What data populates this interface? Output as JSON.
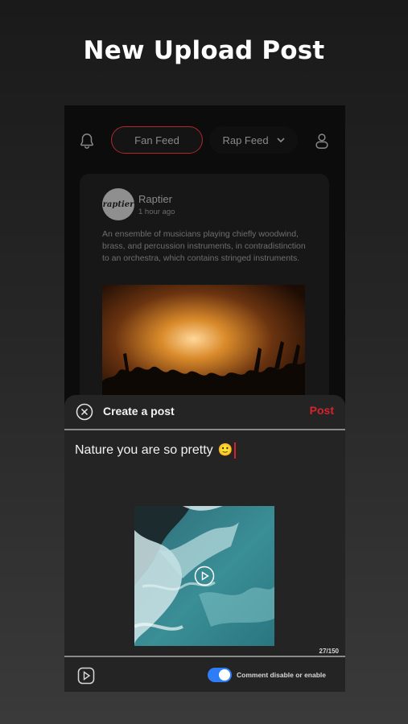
{
  "headline": "New Upload Post",
  "feed": {
    "tabs": [
      {
        "label": "Fan Feed",
        "active": true
      },
      {
        "label": "Rap Feed",
        "active": false
      }
    ],
    "icons": [
      "bell-icon",
      "chevron-down-icon",
      "user-icon"
    ],
    "accent_color": "#b0282c"
  },
  "post": {
    "avatar_text": "raptier",
    "author": "Raptier",
    "time": "1 hour ago",
    "body": "An ensemble of musicians playing chiefly woodwind, brass, and percussion instruments, in contradistinction to an orchestra, which contains stringed instruments."
  },
  "composer": {
    "title": "Create a post",
    "post_label": "Post",
    "post_color": "#d3252a",
    "text": "Nature you are so pretty",
    "emoji": "🙂",
    "char_count": "27/150",
    "toggle_label": "Comment disable or enable",
    "toggle_on": true,
    "icons": [
      "close-circle-icon",
      "play-circle-icon",
      "video-icon"
    ]
  }
}
